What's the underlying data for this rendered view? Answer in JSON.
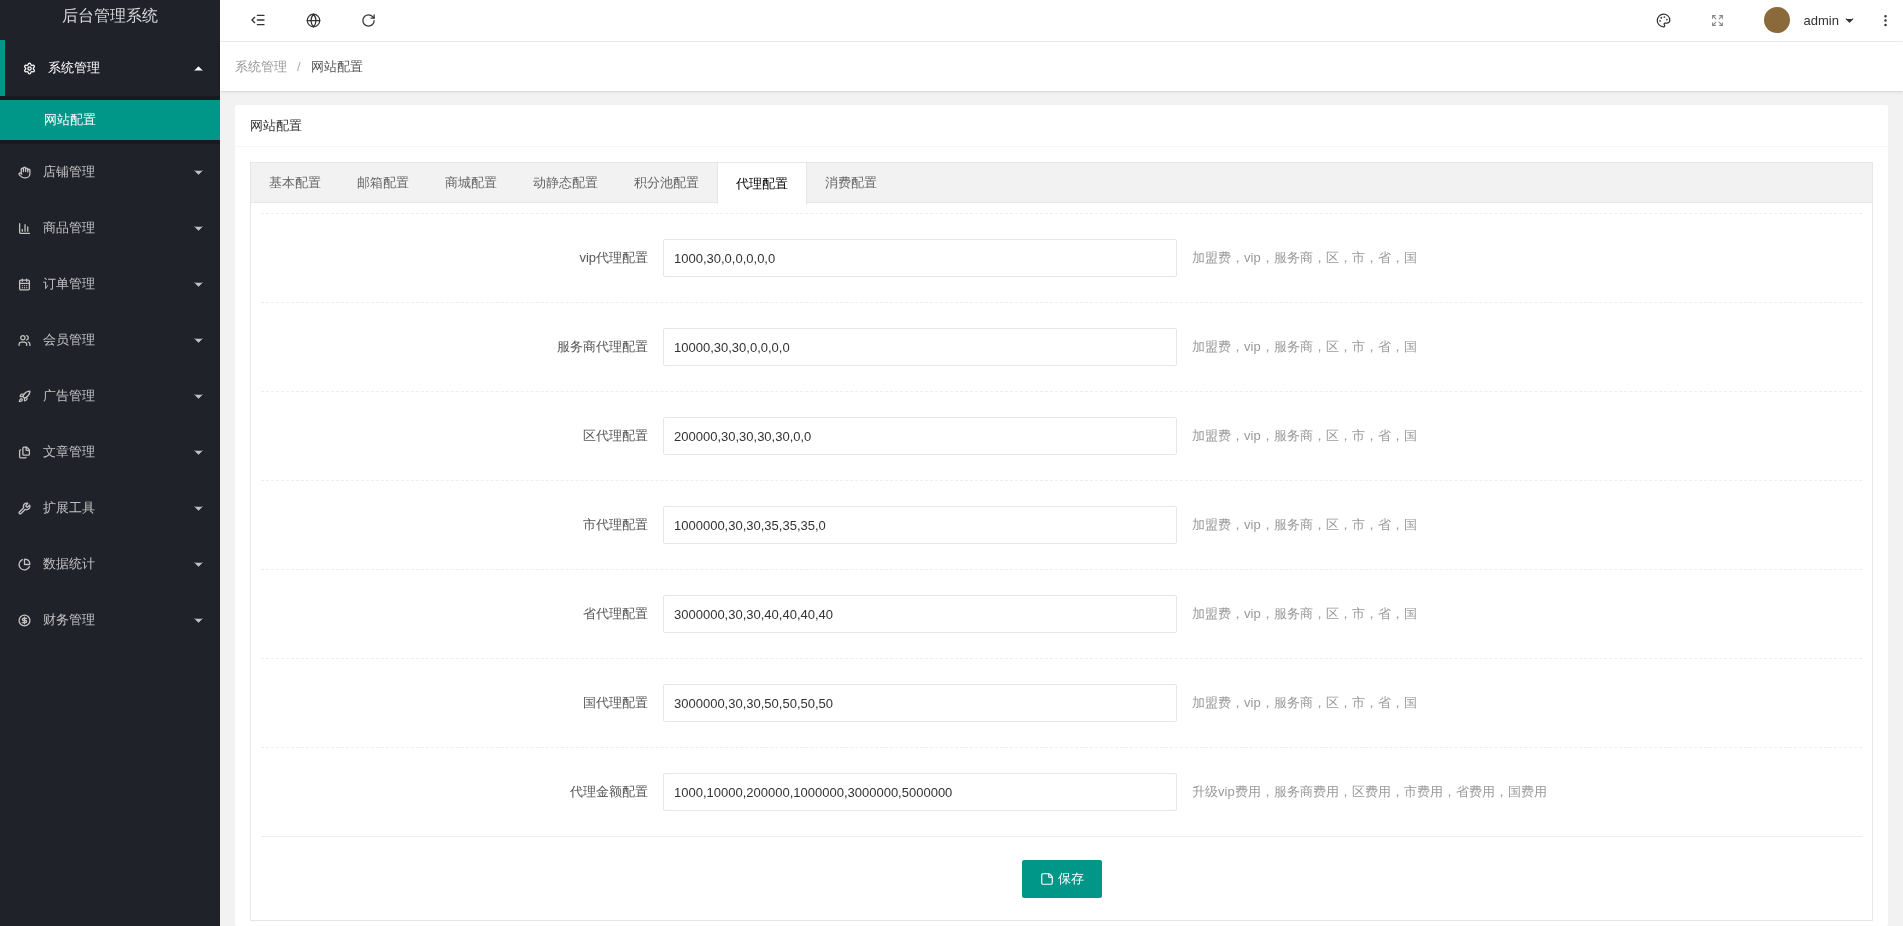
{
  "app_title": "后台管理系统",
  "sidebar": {
    "items": [
      {
        "label": "系统管理",
        "expanded": true,
        "children": [
          {
            "label": "网站配置",
            "selected": true
          }
        ]
      },
      {
        "label": "店铺管理",
        "expanded": false
      },
      {
        "label": "商品管理",
        "expanded": false
      },
      {
        "label": "订单管理",
        "expanded": false
      },
      {
        "label": "会员管理",
        "expanded": false
      },
      {
        "label": "广告管理",
        "expanded": false
      },
      {
        "label": "文章管理",
        "expanded": false
      },
      {
        "label": "扩展工具",
        "expanded": false
      },
      {
        "label": "数据统计",
        "expanded": false
      },
      {
        "label": "财务管理",
        "expanded": false
      }
    ]
  },
  "user": {
    "name": "admin"
  },
  "breadcrumb": {
    "separator": "/",
    "items": [
      "系统管理",
      "网站配置"
    ]
  },
  "card": {
    "title": "网站配置",
    "tabs": [
      {
        "label": "基本配置",
        "selected": false
      },
      {
        "label": "邮箱配置",
        "selected": false
      },
      {
        "label": "商城配置",
        "selected": false
      },
      {
        "label": "动静态配置",
        "selected": false
      },
      {
        "label": "积分池配置",
        "selected": false
      },
      {
        "label": "代理配置",
        "selected": true
      },
      {
        "label": "消费配置",
        "selected": false
      }
    ],
    "fields": [
      {
        "label": "vip代理配置",
        "value": "1000,30,0,0,0,0,0",
        "hint": "加盟费，vip，服务商，区，市，省，国"
      },
      {
        "label": "服务商代理配置",
        "value": "10000,30,30,0,0,0,0",
        "hint": "加盟费，vip，服务商，区，市，省，国"
      },
      {
        "label": "区代理配置",
        "value": "200000,30,30,30,30,0,0",
        "hint": "加盟费，vip，服务商，区，市，省，国"
      },
      {
        "label": "市代理配置",
        "value": "1000000,30,30,35,35,35,0",
        "hint": "加盟费，vip，服务商，区，市，省，国"
      },
      {
        "label": "省代理配置",
        "value": "3000000,30,30,40,40,40,40",
        "hint": "加盟费，vip，服务商，区，市，省，国"
      },
      {
        "label": "国代理配置",
        "value": "3000000,30,30,50,50,50,50",
        "hint": "加盟费，vip，服务商，区，市，省，国"
      },
      {
        "label": "代理金额配置",
        "value": "1000,10000,200000,1000000,3000000,5000000",
        "hint": "升级vip费用，服务商费用，区费用，市费用，省费用，国费用"
      }
    ],
    "save_button": "保存"
  }
}
